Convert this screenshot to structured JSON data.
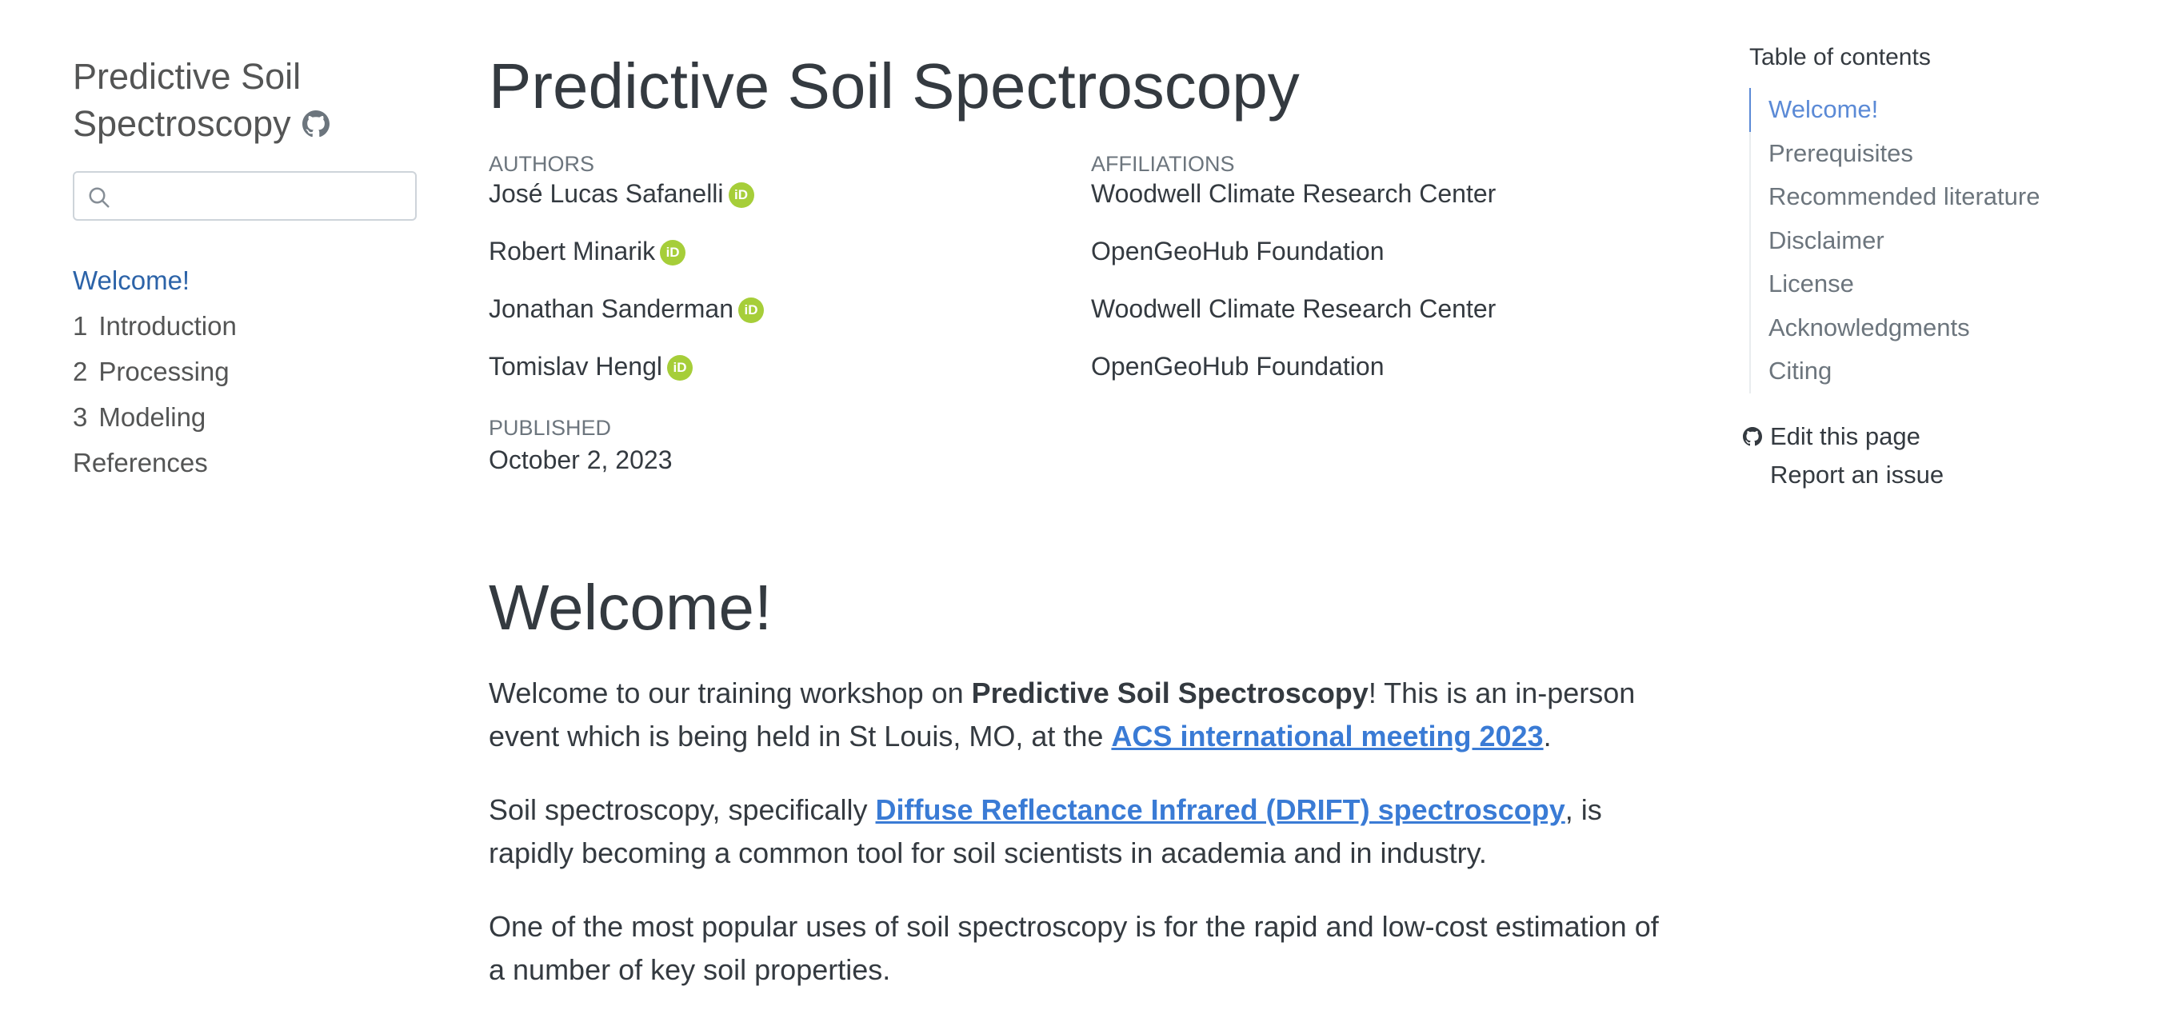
{
  "sidebar": {
    "title_line1": "Predictive Soil",
    "title_line2": "Spectroscopy",
    "search_placeholder": "",
    "nav": [
      {
        "num": "",
        "label": "Welcome!"
      },
      {
        "num": "1",
        "label": "Introduction"
      },
      {
        "num": "2",
        "label": "Processing"
      },
      {
        "num": "3",
        "label": "Modeling"
      },
      {
        "num": "",
        "label": "References"
      }
    ]
  },
  "main": {
    "title": "Predictive Soil Spectroscopy",
    "authors_heading": "Authors",
    "affiliations_heading": "Affiliations",
    "authors": [
      {
        "name": "José Lucas Safanelli",
        "affiliation": "Woodwell Climate Research Center"
      },
      {
        "name": "Robert Minarik",
        "affiliation": "OpenGeoHub Foundation"
      },
      {
        "name": "Jonathan Sanderman",
        "affiliation": "Woodwell Climate Research Center"
      },
      {
        "name": "Tomislav Hengl",
        "affiliation": "OpenGeoHub Foundation"
      }
    ],
    "orcid_label": "iD",
    "published_heading": "Published",
    "published_date": "October 2, 2023",
    "section_title": "Welcome!",
    "p1_a": "Welcome to our training workshop on ",
    "p1_bold": "Predictive Soil Spectroscopy",
    "p1_b": "! This is an in-person event which is being held in St Louis, MO, at the ",
    "p1_link": "ACS international meeting 2023",
    "p1_c": ".",
    "p2_a": "Soil spectroscopy, specifically ",
    "p2_link": "Diffuse Reflectance Infrared (DRIFT) spectroscopy",
    "p2_b": ", is rapidly becoming a common tool for soil scientists in academia and in industry.",
    "p3": "One of the most popular uses of soil spectroscopy is for the rapid and low-cost estimation of a number of key soil properties."
  },
  "toc": {
    "title": "Table of contents",
    "items": [
      "Welcome!",
      "Prerequisites",
      "Recommended literature",
      "Disclaimer",
      "License",
      "Acknowledgments",
      "Citing"
    ],
    "edit_page": "Edit this page",
    "report_issue": "Report an issue"
  },
  "colors": {
    "link": "#3a7bd5",
    "active_nav": "#2c63a8",
    "orcid": "#a6ce39",
    "toc_active": "#5b8ad6"
  }
}
